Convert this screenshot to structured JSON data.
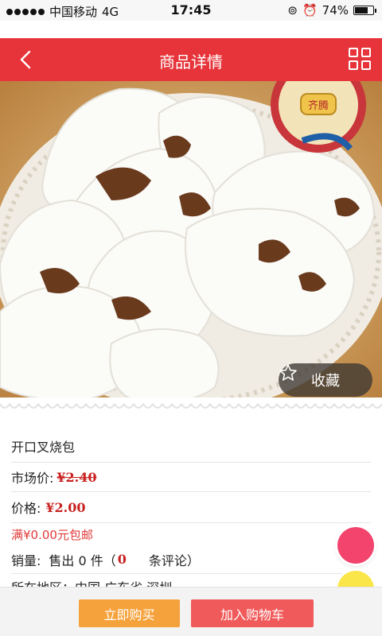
{
  "status_bar": {
    "carrier": "中国移动",
    "network": "4G",
    "time": "17:45",
    "battery": "74%",
    "battery_level": 0.74
  },
  "header": {
    "title": "商品详情",
    "back_icon": "chevron-left-icon",
    "menu_icon": "grid-icon"
  },
  "hero": {
    "logo_text": "齐腾",
    "favorite_label": "收藏",
    "favorite_icon": "star-outline-icon"
  },
  "product": {
    "name": "开口叉烧包",
    "market_price_label": "市场价:",
    "market_price": "¥2.40",
    "price_label": "价格:",
    "price": "¥2.00",
    "shipping": "满¥0.00元包邮",
    "sales_label": "销量:",
    "sales_text": "售出 0 件（",
    "review_count": "0",
    "review_label": "条评论）",
    "region_label": "所在地区：",
    "region": "中国 广东省 深圳"
  },
  "actions": {
    "buy_now": "立即购买",
    "add_to_cart": "加入购物车"
  },
  "colors": {
    "header": "#e7343a",
    "price": "#c8201f",
    "buy_button": "#f6a23c",
    "cart_button": "#f15a5a",
    "float_pink": "#f2446d",
    "float_yellow": "#fbe64a"
  }
}
